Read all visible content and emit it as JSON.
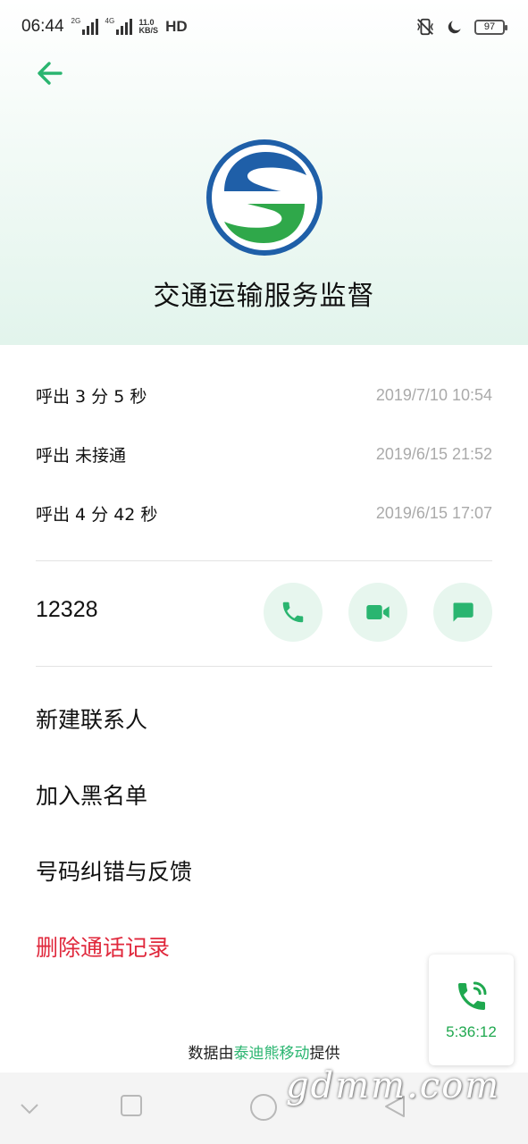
{
  "status_bar": {
    "time": "06:44",
    "sim1_tag": "2G",
    "sim2_tag": "4G",
    "speed_value": "11.0",
    "speed_unit": "KB/S",
    "hd_label": "HD",
    "battery": "97"
  },
  "contact": {
    "name": "交通运输服务监督",
    "number": "12328"
  },
  "call_log": [
    {
      "type": "呼出  3 分 5 秒",
      "time": "2019/7/10 10:54"
    },
    {
      "type": "呼出 未接通",
      "time": "2019/6/15 21:52"
    },
    {
      "type": "呼出  4 分 42 秒",
      "time": "2019/6/15 17:07"
    }
  ],
  "menu": {
    "new_contact": "新建联系人",
    "blacklist": "加入黑名单",
    "correction": "号码纠错与反馈",
    "delete_log": "删除通话记录"
  },
  "footer": {
    "prefix": "数据由",
    "provider": "泰迪熊移动",
    "suffix": "提供"
  },
  "floating_call": {
    "duration": "5:36:12"
  },
  "watermark": "gdmm.com",
  "colors": {
    "accent_green": "#2ab570",
    "danger_red": "#e0283c",
    "float_green": "#1fa84f"
  },
  "icons": {
    "back": "arrow-left-icon",
    "call": "phone-icon",
    "video": "video-camera-icon",
    "message": "message-bubble-icon",
    "mute": "vibrate-off-icon",
    "dnd": "moon-icon",
    "ongoing_call": "phone-ringing-icon"
  }
}
